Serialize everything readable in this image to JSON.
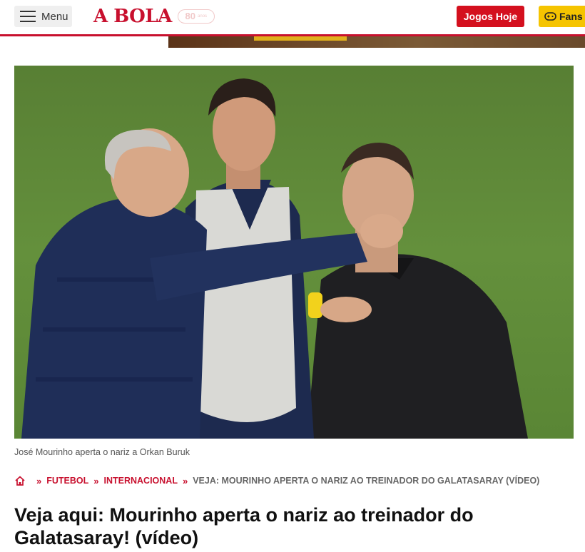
{
  "header": {
    "menu_label": "Menu",
    "logo_text": "A BOLA",
    "anniversary_number": "80",
    "anniversary_label": "anos",
    "jogos_label": "Jogos Hoje",
    "fans_label": "Fans"
  },
  "colors": {
    "brand_red": "#c8102e",
    "jogos_red": "#d4101e",
    "fans_yellow": "#f5c400"
  },
  "article": {
    "caption": "José Mourinho aperta o nariz a Orkan Buruk",
    "breadcrumb": [
      {
        "label": "FUTEBOL"
      },
      {
        "label": "INTERNACIONAL"
      },
      {
        "label": "VEJA: MOURINHO APERTA O NARIZ AO TREINADOR DO GALATASARAY (VÍDEO)"
      }
    ],
    "headline_line1": "Veja aqui: Mourinho aperta o nariz ao treinador do",
    "headline_line2": "Galatasaray! (vídeo)"
  },
  "icons": [
    "hamburger-icon",
    "home-icon",
    "gamepad-icon"
  ]
}
